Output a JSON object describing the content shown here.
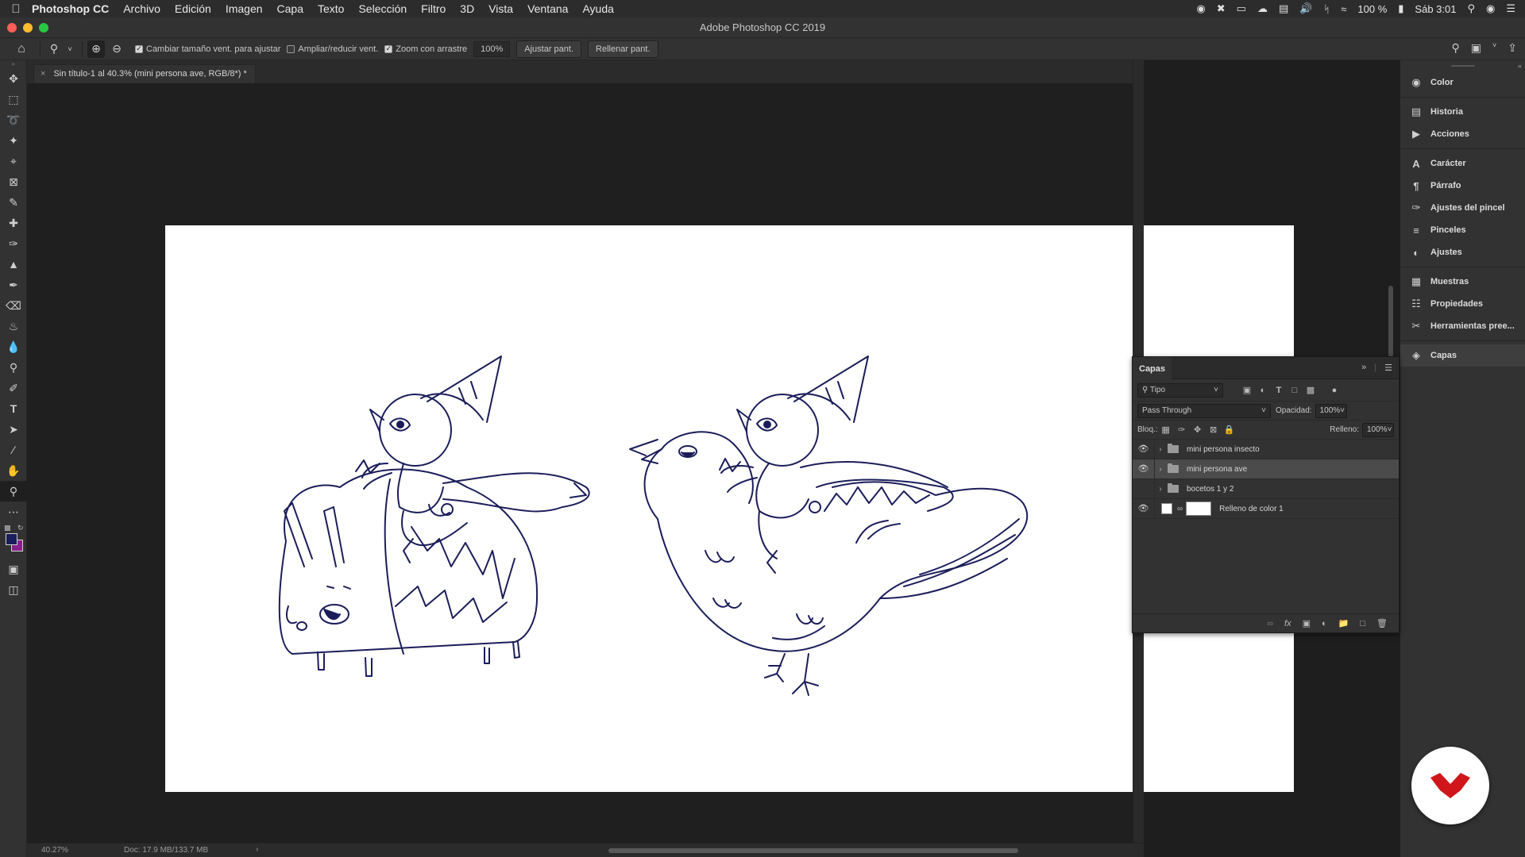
{
  "menubar": {
    "app": "Photoshop CC",
    "items": [
      "Archivo",
      "Edición",
      "Imagen",
      "Capa",
      "Texto",
      "Selección",
      "Filtro",
      "3D",
      "Vista",
      "Ventana",
      "Ayuda"
    ],
    "battery": "100 %",
    "clock": "Sáb 3:01"
  },
  "window": {
    "title": "Adobe Photoshop CC 2019"
  },
  "options": {
    "resize_windows": "Cambiar tamaño vent. para ajustar",
    "zoom_all": "Ampliar/reducir vent.",
    "scrubby_zoom": "Zoom con arrastre",
    "zoom_value": "100%",
    "fit_screen": "Ajustar pant.",
    "fill_screen": "Rellenar pant."
  },
  "document": {
    "tab_title": "Sin título-1 al 40.3% (mini persona ave, RGB/8*) *"
  },
  "status": {
    "zoom": "40.27%",
    "doc": "Doc: 17.9 MB/133.7 MB"
  },
  "right_panel": {
    "items": [
      {
        "label": "Color",
        "icon": "color-icon"
      },
      {
        "label": "Historia",
        "icon": "history-icon"
      },
      {
        "label": "Acciones",
        "icon": "actions-icon"
      },
      {
        "label": "Carácter",
        "icon": "character-icon"
      },
      {
        "label": "Párrafo",
        "icon": "paragraph-icon"
      },
      {
        "label": "Ajustes del pincel",
        "icon": "brush-settings-icon"
      },
      {
        "label": "Pinceles",
        "icon": "brushes-icon"
      },
      {
        "label": "Ajustes",
        "icon": "adjustments-icon"
      },
      {
        "label": "Muestras",
        "icon": "swatches-icon"
      },
      {
        "label": "Propiedades",
        "icon": "properties-icon"
      },
      {
        "label": "Herramientas pree...",
        "icon": "tool-presets-icon"
      },
      {
        "label": "Capas",
        "icon": "layers-icon"
      }
    ]
  },
  "layers_panel": {
    "title": "Capas",
    "filter": "Tipo",
    "blend_mode": "Pass Through",
    "opacity_label": "Opacidad:",
    "opacity": "100%",
    "lock_label": "Bloq.:",
    "fill_label": "Relleno:",
    "fill": "100%",
    "layers": [
      {
        "name": "mini persona insecto",
        "visible": true,
        "type": "group",
        "selected": false
      },
      {
        "name": "mini persona ave",
        "visible": true,
        "type": "group",
        "selected": true
      },
      {
        "name": "bocetos 1 y 2",
        "visible": false,
        "type": "group",
        "selected": false
      },
      {
        "name": "Relleno de color 1",
        "visible": true,
        "type": "fill",
        "selected": false
      }
    ]
  },
  "colors": {
    "foreground": "#1b1d5a",
    "background": "#8a1e8a",
    "brand_red": "#d0161b"
  }
}
